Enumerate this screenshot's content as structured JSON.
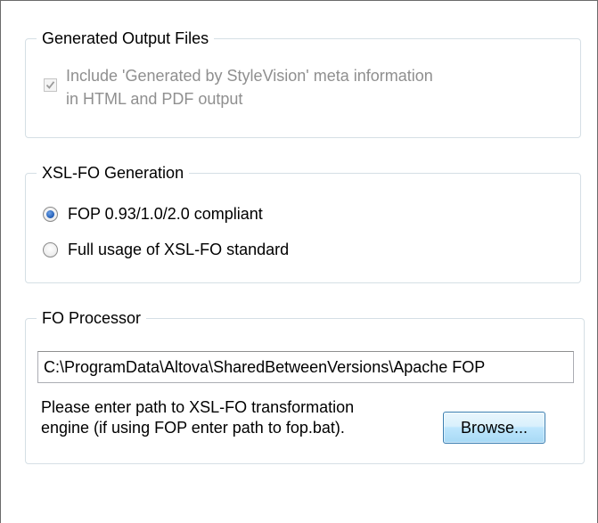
{
  "generated_output": {
    "title": "Generated Output Files",
    "checkbox_line1": "Include 'Generated by StyleVision' meta information",
    "checkbox_line2": "in HTML and PDF output",
    "checked": true,
    "enabled": false
  },
  "xslfo_generation": {
    "title": "XSL-FO Generation",
    "options": [
      {
        "label": "FOP 0.93/1.0/2.0 compliant",
        "selected": true
      },
      {
        "label": "Full usage of XSL-FO standard",
        "selected": false
      }
    ]
  },
  "fo_processor": {
    "title": "FO Processor",
    "path_value": "C:\\ProgramData\\Altova\\SharedBetweenVersions\\Apache FOP",
    "help_line1": "Please enter path to XSL-FO transformation",
    "help_line2": "engine (if using FOP enter path to fop.bat).",
    "browse_label": "Browse..."
  },
  "colors": {
    "group_border": "#d5dfe5",
    "disabled_text": "#8f8f8f",
    "radio_selected": "#1f5bb5",
    "button_border": "#3c7fb1"
  }
}
